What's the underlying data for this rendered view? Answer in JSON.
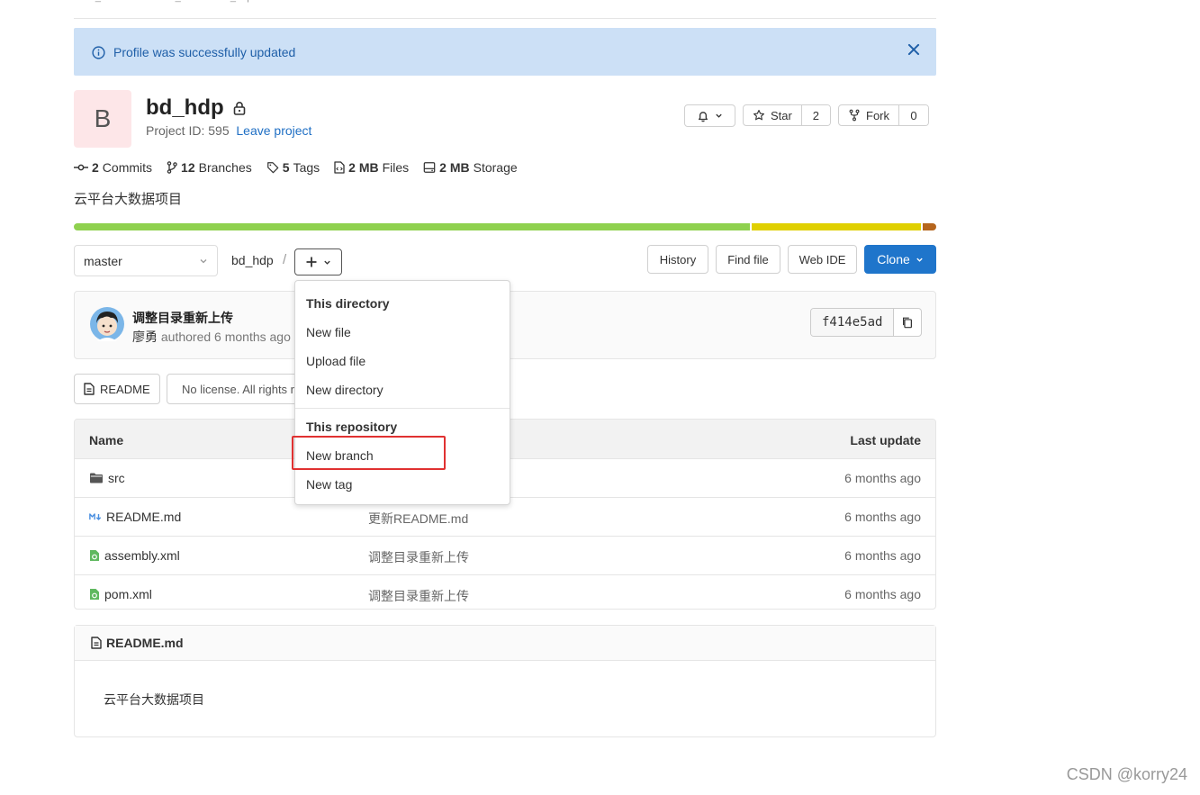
{
  "breadcrumb": [
    "base_data",
    "software_sdbs",
    "bd_hdp"
  ],
  "flash": {
    "message": "Profile was successfully updated"
  },
  "project": {
    "avatar_letter": "B",
    "name": "bd_hdp",
    "id_label": "Project ID: 595",
    "leave_link": "Leave project",
    "description": "云平台大数据项目"
  },
  "actions": {
    "star_label": "Star",
    "star_count": "2",
    "fork_label": "Fork",
    "fork_count": "0"
  },
  "stats": {
    "commits_num": "2",
    "commits_label": "Commits",
    "branches_num": "12",
    "branches_label": "Branches",
    "tags_num": "5",
    "tags_label": "Tags",
    "files_num": "2 MB",
    "files_label": "Files",
    "storage_num": "2 MB",
    "storage_label": "Storage"
  },
  "language_bar": [
    {
      "color": "#8fd14f",
      "fraction": 0.787
    },
    {
      "color": "#e0d000",
      "fraction": 0.197
    },
    {
      "color": "#b5651d",
      "fraction": 0.016
    }
  ],
  "toolbar": {
    "branch": "master",
    "path_root": "bd_hdp",
    "path_sep": "/",
    "history": "History",
    "find_file": "Find file",
    "web_ide": "Web IDE",
    "clone": "Clone"
  },
  "commit": {
    "title": "调整目录重新上传",
    "author": "廖勇",
    "meta": "authored 6 months ago",
    "sha": "f414e5ad"
  },
  "buttons": {
    "readme": "README",
    "license": "No license. All rights reserved"
  },
  "table": {
    "col_name": "Name",
    "col_last_update": "Last update",
    "rows": [
      {
        "name": "src",
        "message": "",
        "time": "6 months ago"
      },
      {
        "name": "README.md",
        "message": "更新README.md",
        "time": "6 months ago"
      },
      {
        "name": "assembly.xml",
        "message": "调整目录重新上传",
        "time": "6 months ago"
      },
      {
        "name": "pom.xml",
        "message": "调整目录重新上传",
        "time": "6 months ago"
      }
    ]
  },
  "readme_panel": {
    "filename": "README.md",
    "content": "云平台大数据项目"
  },
  "dropdown": {
    "section1": "This directory",
    "new_file": "New file",
    "upload_file": "Upload file",
    "new_directory": "New directory",
    "section2": "This repository",
    "new_branch": "New branch",
    "new_tag": "New tag"
  },
  "watermark": "CSDN @korry24"
}
